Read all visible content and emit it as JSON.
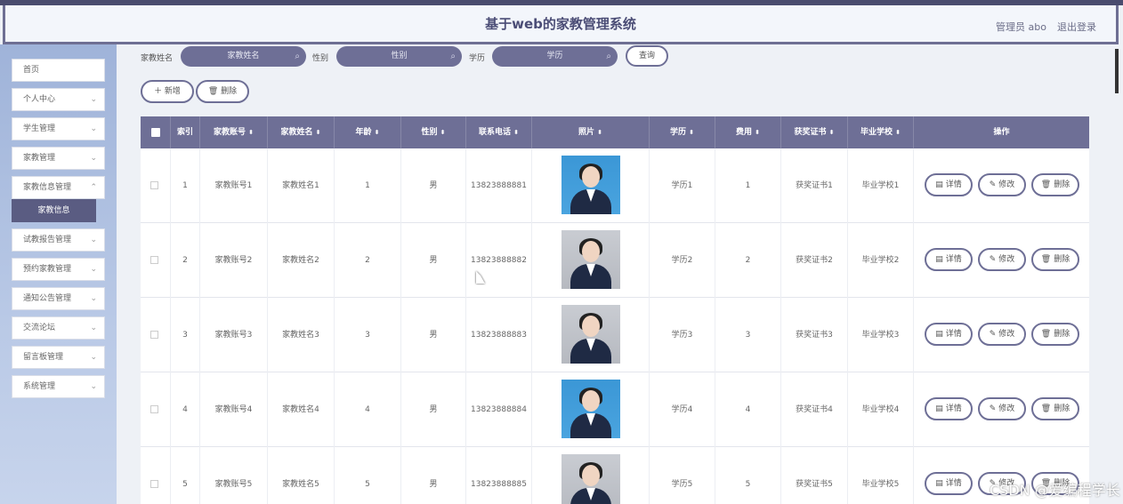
{
  "header": {
    "title": "基于web的家教管理系统",
    "user": "管理员 abo",
    "logout": "退出登录"
  },
  "sidebar": {
    "items": [
      {
        "label": "首页",
        "chevron": false
      },
      {
        "label": "个人中心",
        "chevron": true
      },
      {
        "label": "学生管理",
        "chevron": true
      },
      {
        "label": "家教管理",
        "chevron": true
      },
      {
        "label": "家教信息管理",
        "chevron": true
      },
      {
        "label": "试教报告管理",
        "chevron": true
      },
      {
        "label": "预约家教管理",
        "chevron": true
      },
      {
        "label": "通知公告管理",
        "chevron": true
      },
      {
        "label": "交流论坛",
        "chevron": true
      },
      {
        "label": "留言板管理",
        "chevron": true
      },
      {
        "label": "系统管理",
        "chevron": true
      }
    ],
    "active_sub": "家教信息"
  },
  "search": {
    "name_label": "家教姓名",
    "name_placeholder": "家教姓名",
    "gender_label": "性别",
    "gender_placeholder": "性别",
    "edu_label": "学历",
    "edu_placeholder": "学历",
    "query_button": "查询"
  },
  "toolbar": {
    "add_button": "＋ 新增",
    "delete_button": "删除"
  },
  "table": {
    "headers": [
      "索引",
      "家教账号",
      "家教姓名",
      "年龄",
      "性别",
      "联系电话",
      "照片",
      "学历",
      "费用",
      "获奖证书",
      "毕业学校",
      "操作"
    ],
    "rows": [
      {
        "index": "1",
        "account": "家教账号1",
        "name": "家教姓名1",
        "age": "1",
        "gender": "男",
        "phone": "13823888881",
        "edu": "学历1",
        "fee": "1",
        "cert": "获奖证书1",
        "school": "毕业学校1"
      },
      {
        "index": "2",
        "account": "家教账号2",
        "name": "家教姓名2",
        "age": "2",
        "gender": "男",
        "phone": "13823888882",
        "edu": "学历2",
        "fee": "2",
        "cert": "获奖证书2",
        "school": "毕业学校2"
      },
      {
        "index": "3",
        "account": "家教账号3",
        "name": "家教姓名3",
        "age": "3",
        "gender": "男",
        "phone": "13823888883",
        "edu": "学历3",
        "fee": "3",
        "cert": "获奖证书3",
        "school": "毕业学校3"
      },
      {
        "index": "4",
        "account": "家教账号4",
        "name": "家教姓名4",
        "age": "4",
        "gender": "男",
        "phone": "13823888884",
        "edu": "学历4",
        "fee": "4",
        "cert": "获奖证书4",
        "school": "毕业学校4"
      },
      {
        "index": "5",
        "account": "家教账号5",
        "name": "家教姓名5",
        "age": "5",
        "gender": "男",
        "phone": "13823888885",
        "edu": "学历5",
        "fee": "5",
        "cert": "获奖证书5",
        "school": "毕业学校5"
      }
    ],
    "actions": {
      "detail": "详情",
      "edit": "修改",
      "delete": "删除"
    }
  },
  "watermark": "CSDN @爱编程学长",
  "colors": {
    "accent": "#6e6f96",
    "header_border": "#6e6f93",
    "sidebar": "#a8bbe0",
    "active_sub": "#5a5c82"
  }
}
